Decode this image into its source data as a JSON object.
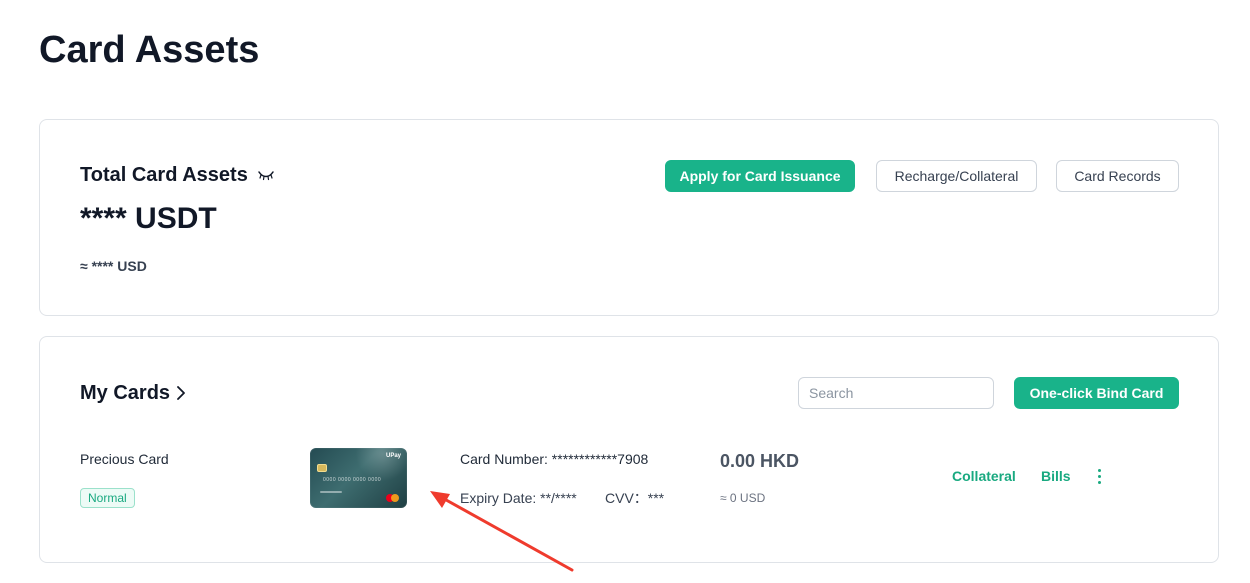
{
  "page": {
    "title": "Card Assets"
  },
  "assets": {
    "label": "Total Card Assets",
    "amount": "**** USDT",
    "usd": "≈ **** USD",
    "buttons": {
      "apply": "Apply for Card Issuance",
      "recharge": "Recharge/Collateral",
      "records": "Card Records"
    }
  },
  "cards": {
    "title": "My Cards",
    "search_placeholder": "Search",
    "bind_button": "One-click Bind Card",
    "items": [
      {
        "name": "Precious Card",
        "status": "Normal",
        "card_number": "Card Number: ************7908",
        "expiry": "Expiry Date: **/****",
        "cvv": "CVV：***",
        "balance": "0.00 HKD",
        "balance_usd": "≈ 0 USD",
        "actions": {
          "collateral": "Collateral",
          "bills": "Bills"
        },
        "thumbnail": {
          "brand": "UPay",
          "digits": "0000 0000 0000 0000"
        }
      }
    ]
  },
  "colors": {
    "accent": "#19b38a",
    "accent_text": "#19a980",
    "annotation_arrow": "#ef3b2d"
  },
  "icons": {
    "eye": "eye-closed-icon",
    "chevron": "chevron-right-icon",
    "more": "more-vertical-icon",
    "chip": "card-chip-icon",
    "card_network": "mastercard-logo-icon",
    "arrow": "red-annotation-arrow-icon"
  }
}
